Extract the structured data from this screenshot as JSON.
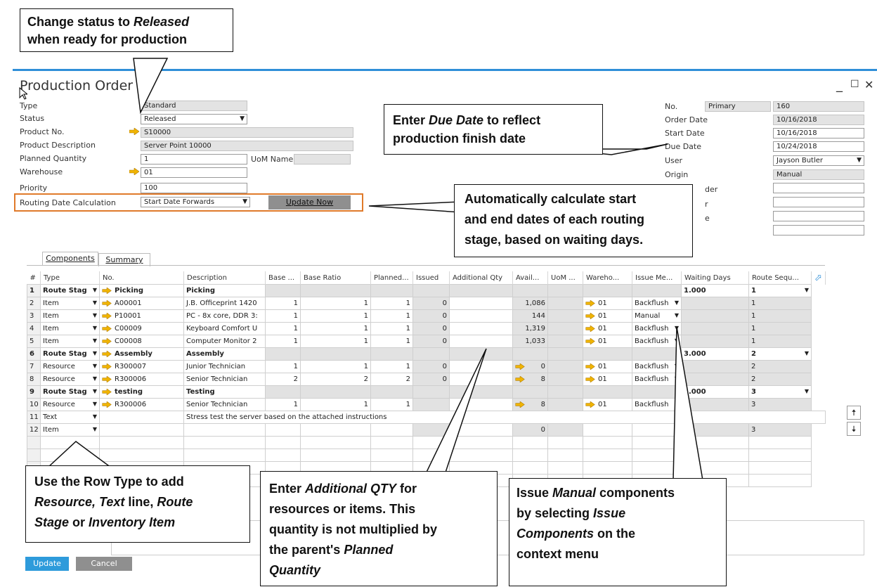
{
  "window": {
    "title": "Production Order"
  },
  "header_left": {
    "type": {
      "label": "Type",
      "value": "Standard"
    },
    "status": {
      "label": "Status",
      "value": "Released"
    },
    "product_no": {
      "label": "Product No.",
      "value": "S10000"
    },
    "product_description": {
      "label": "Product Description",
      "value": "Server Point 10000"
    },
    "planned_quantity": {
      "label": "Planned Quantity",
      "value": "1"
    },
    "uom_name": {
      "label": "UoM Name",
      "value": ""
    },
    "warehouse": {
      "label": "Warehouse",
      "value": "01"
    },
    "priority": {
      "label": "Priority",
      "value": "100"
    },
    "routing_date_calc": {
      "label": "Routing Date Calculation",
      "value": "Start Date Forwards"
    },
    "update_now": "Update Now"
  },
  "header_right": {
    "no": {
      "label": "No.",
      "series": "Primary",
      "value": "160"
    },
    "order_date": {
      "label": "Order Date",
      "value": "10/16/2018"
    },
    "start_date": {
      "label": "Start Date",
      "value": "10/16/2018"
    },
    "due_date": {
      "label": "Due Date",
      "value": "10/24/2018"
    },
    "user": {
      "label": "User",
      "value": "Jayson Butler"
    },
    "origin": {
      "label": "Origin",
      "value": "Manual"
    },
    "partial_labels": [
      "der",
      "r",
      "e"
    ]
  },
  "tabs": [
    "Components",
    "Summary"
  ],
  "grid": {
    "columns": [
      "#",
      "Type",
      "No.",
      "Description",
      "Base ...",
      "Base Ratio",
      "Planned...",
      "Issued",
      "Additional Qty",
      "Avail...",
      "UoM ...",
      "Wareho...",
      "Issue Me...",
      "Waiting Days",
      "Route Sequ..."
    ],
    "rows": [
      {
        "num": "1",
        "type": "Route Stag",
        "arrow": true,
        "no": "Picking",
        "desc": "Picking",
        "base": "",
        "ratio": "",
        "planned": "",
        "issued": "",
        "addl": "",
        "avail": "",
        "avail_arrow": false,
        "uom": "",
        "wh": "",
        "issue": "",
        "wait": "1.000",
        "route": "1",
        "kind": "route"
      },
      {
        "num": "2",
        "type": "Item",
        "arrow": true,
        "no": "A00001",
        "desc": "J.B. Officeprint 1420",
        "base": "1",
        "ratio": "1",
        "planned": "1",
        "issued": "0",
        "addl": "",
        "avail": "1,086",
        "avail_arrow": false,
        "uom": "",
        "wh": "01",
        "issue": "Backflush",
        "wait": "",
        "route": "1",
        "kind": "item"
      },
      {
        "num": "3",
        "type": "Item",
        "arrow": true,
        "no": "P10001",
        "desc": "PC - 8x core, DDR 3:",
        "base": "1",
        "ratio": "1",
        "planned": "1",
        "issued": "0",
        "addl": "",
        "avail": "144",
        "avail_arrow": false,
        "uom": "",
        "wh": "01",
        "issue": "Manual",
        "wait": "",
        "route": "1",
        "kind": "item"
      },
      {
        "num": "4",
        "type": "Item",
        "arrow": true,
        "no": "C00009",
        "desc": "Keyboard Comfort U",
        "base": "1",
        "ratio": "1",
        "planned": "1",
        "issued": "0",
        "addl": "",
        "avail": "1,319",
        "avail_arrow": false,
        "uom": "",
        "wh": "01",
        "issue": "Backflush",
        "wait": "",
        "route": "1",
        "kind": "item"
      },
      {
        "num": "5",
        "type": "Item",
        "arrow": true,
        "no": "C00008",
        "desc": "Computer Monitor 2",
        "base": "1",
        "ratio": "1",
        "planned": "1",
        "issued": "0",
        "addl": "",
        "avail": "1,033",
        "avail_arrow": false,
        "uom": "",
        "wh": "01",
        "issue": "Backflush",
        "wait": "",
        "route": "1",
        "kind": "item"
      },
      {
        "num": "6",
        "type": "Route Stag",
        "arrow": true,
        "no": "Assembly",
        "desc": "Assembly",
        "base": "",
        "ratio": "",
        "planned": "",
        "issued": "",
        "addl": "",
        "avail": "",
        "avail_arrow": false,
        "uom": "",
        "wh": "",
        "issue": "",
        "wait": "3.000",
        "route": "2",
        "kind": "route"
      },
      {
        "num": "7",
        "type": "Resource",
        "arrow": true,
        "no": "R300007",
        "desc": "Junior Technician",
        "base": "1",
        "ratio": "1",
        "planned": "1",
        "issued": "0",
        "addl": "",
        "avail": "0",
        "avail_arrow": true,
        "uom": "",
        "wh": "01",
        "issue": "Backflush",
        "wait": "",
        "route": "2",
        "kind": "item"
      },
      {
        "num": "8",
        "type": "Resource",
        "arrow": true,
        "no": "R300006",
        "desc": "Senior Technician",
        "base": "2",
        "ratio": "2",
        "planned": "2",
        "issued": "0",
        "addl": "",
        "avail": "8",
        "avail_arrow": true,
        "uom": "",
        "wh": "01",
        "issue": "Backflush",
        "wait": "",
        "route": "2",
        "kind": "item"
      },
      {
        "num": "9",
        "type": "Route Stag",
        "arrow": true,
        "no": "testing",
        "desc": "Testing",
        "base": "",
        "ratio": "",
        "planned": "",
        "issued": "",
        "addl": "",
        "avail": "",
        "avail_arrow": false,
        "uom": "",
        "wh": "",
        "issue": "",
        "wait": "2.000",
        "route": "3",
        "kind": "route"
      },
      {
        "num": "10",
        "type": "Resource",
        "arrow": true,
        "no": "R300006",
        "desc": "Senior Technician",
        "base": "1",
        "ratio": "1",
        "planned": "1",
        "issued": "",
        "addl": "",
        "avail": "8",
        "avail_arrow": true,
        "uom": "",
        "wh": "01",
        "issue": "Backflush",
        "wait": "",
        "route": "3",
        "kind": "item"
      },
      {
        "num": "11",
        "type": "Text",
        "arrow": false,
        "no": "",
        "desc": "Stress test the server based on the attached instructions",
        "kind": "text"
      },
      {
        "num": "12",
        "type": "Item",
        "arrow": false,
        "no": "",
        "desc": "",
        "base": "",
        "ratio": "",
        "planned": "",
        "issued": "",
        "addl": "",
        "avail": "0",
        "avail_arrow": false,
        "uom": "",
        "wh": "",
        "issue": "",
        "wait": "",
        "route": "3",
        "kind": "item"
      }
    ]
  },
  "footer": {
    "update": "Update",
    "cancel": "Cancel"
  },
  "callouts": {
    "status": [
      "Change status to ",
      "Released",
      "when ready for production"
    ],
    "due_date": [
      "Enter ",
      "Due Date",
      " to reflect",
      "production finish date"
    ],
    "routing": [
      "Automatically calculate start",
      "and end dates of each routing",
      "stage, based on waiting days."
    ],
    "row_type": [
      "Use the Row Type to add",
      "Resource, Text",
      " line, ",
      "Route",
      "Stage",
      " or ",
      "Inventory Item"
    ],
    "additional": [
      "Enter ",
      "Additional QTY",
      " for",
      "resources or items. This",
      "quantity is not multiplied by",
      "the parent's ",
      "Planned",
      "Quantity"
    ],
    "issue": [
      "Issue ",
      "Manual",
      " components",
      "by selecting ",
      "Issue",
      "Components",
      " on the",
      "context menu"
    ]
  },
  "colors": {
    "accent": "#2f8fd8",
    "arrow": "#f0b400",
    "highlight_box": "#e07a2a",
    "update_button": "#2e9bdb"
  }
}
